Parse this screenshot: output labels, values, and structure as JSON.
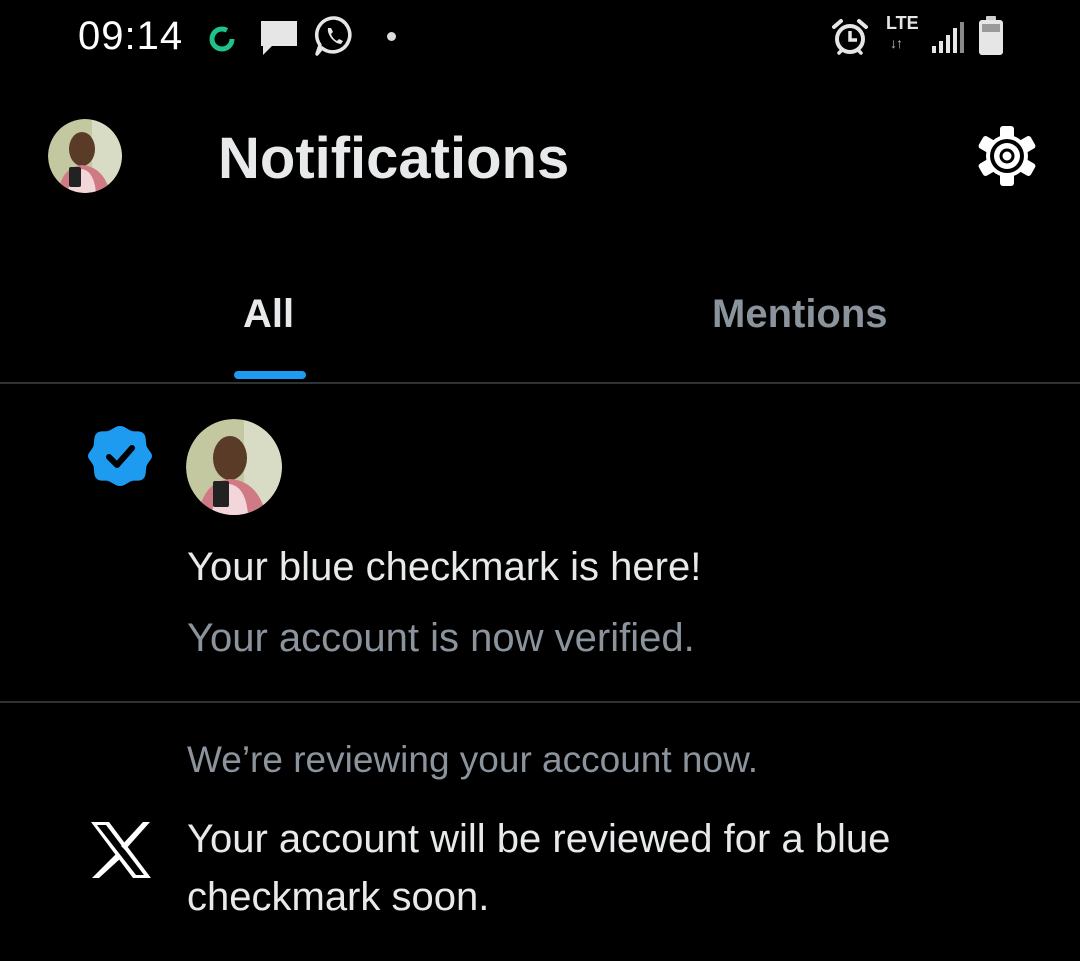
{
  "status_bar": {
    "time": "09:14",
    "network": "LTE",
    "icons": [
      "sync-icon",
      "message-icon",
      "whatsapp-icon",
      "dot-indicator",
      "alarm-icon",
      "lte-icon",
      "signal-icon",
      "battery-icon"
    ]
  },
  "header": {
    "title": "Notifications",
    "settings_icon": "gear-icon"
  },
  "tabs": [
    {
      "label": "All",
      "active": true
    },
    {
      "label": "Mentions",
      "active": false
    }
  ],
  "notifications": [
    {
      "icon": "verified-badge-icon",
      "title": "Your blue checkmark is here!",
      "subtitle": "Your account is now verified."
    },
    {
      "icon": "x-logo-icon",
      "preface": "We’re reviewing your account now.",
      "body": "Your account will be reviewed for a blue checkmark soon."
    }
  ],
  "colors": {
    "background": "#000000",
    "accent": "#1d9bf0",
    "text_primary": "#e7e9ea",
    "text_secondary": "#8b939c",
    "divider": "#2f3336"
  }
}
